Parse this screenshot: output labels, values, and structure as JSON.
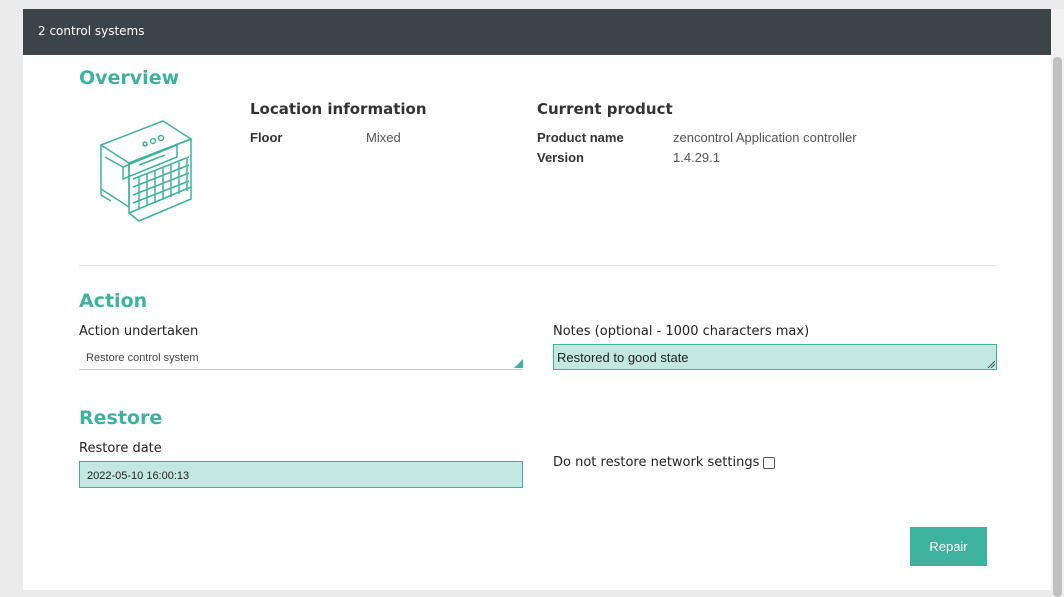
{
  "header": {
    "title": "2 control systems"
  },
  "overview": {
    "heading": "Overview",
    "device_icon": "controller-device-icon",
    "location": {
      "heading": "Location information",
      "floor_label": "Floor",
      "floor_value": "Mixed"
    },
    "product": {
      "heading": "Current product",
      "name_label": "Product name",
      "name_value": "zencontrol Application controller",
      "version_label": "Version",
      "version_value": "1.4.29.1"
    }
  },
  "action": {
    "heading": "Action",
    "undertaken_label": "Action undertaken",
    "undertaken_value": "Restore control system",
    "notes_label": "Notes (optional - 1000 characters max)",
    "notes_value": "Restored to good state"
  },
  "restore": {
    "heading": "Restore",
    "date_label": "Restore date",
    "date_value": "2022-05-10 16:00:13",
    "network_label": "Do not restore network settings",
    "network_checked": false
  },
  "buttons": {
    "repair_label": "Repair"
  },
  "colors": {
    "accent": "#3db39e",
    "header_bg": "#3b4449",
    "field_bg": "#c2e8e1"
  }
}
